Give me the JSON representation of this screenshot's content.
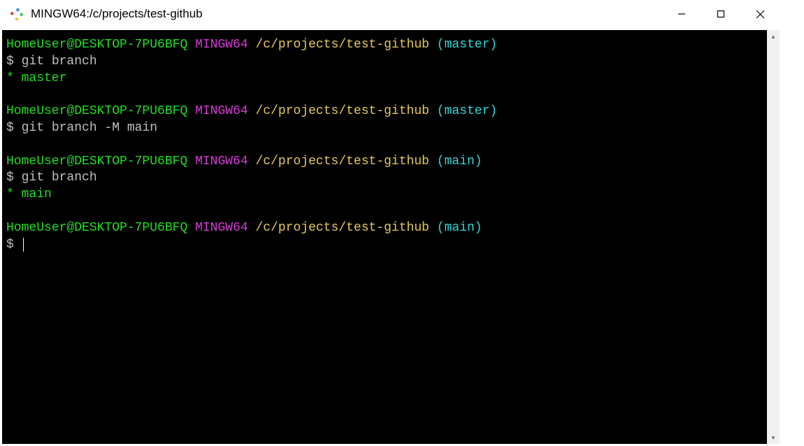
{
  "titlebar": {
    "title": "MINGW64:/c/projects/test-github"
  },
  "colors": {
    "userHost": "#22dd22",
    "mingw": "#d63ad6",
    "path": "#e8c85a",
    "branch": "#33d6d6",
    "prompt": "#c0c0c0",
    "cmd": "#c0c0c0",
    "curBranch": "#22dd22"
  },
  "blocks": [
    {
      "userHost": "HomeUser@DESKTOP-7PU6BFQ",
      "mingw": "MINGW64",
      "path": "/c/projects/test-github",
      "branch": "(master)",
      "cmd": "git branch",
      "output": [
        {
          "text": "* master",
          "colorKey": "curBranch"
        }
      ]
    },
    {
      "userHost": "HomeUser@DESKTOP-7PU6BFQ",
      "mingw": "MINGW64",
      "path": "/c/projects/test-github",
      "branch": "(master)",
      "cmd": "git branch -M main",
      "output": []
    },
    {
      "userHost": "HomeUser@DESKTOP-7PU6BFQ",
      "mingw": "MINGW64",
      "path": "/c/projects/test-github",
      "branch": "(main)",
      "cmd": "git branch",
      "output": [
        {
          "text": "* main",
          "colorKey": "curBranch"
        }
      ]
    },
    {
      "userHost": "HomeUser@DESKTOP-7PU6BFQ",
      "mingw": "MINGW64",
      "path": "/c/projects/test-github",
      "branch": "(main)",
      "cmd": "",
      "output": [],
      "cursor": true
    }
  ]
}
